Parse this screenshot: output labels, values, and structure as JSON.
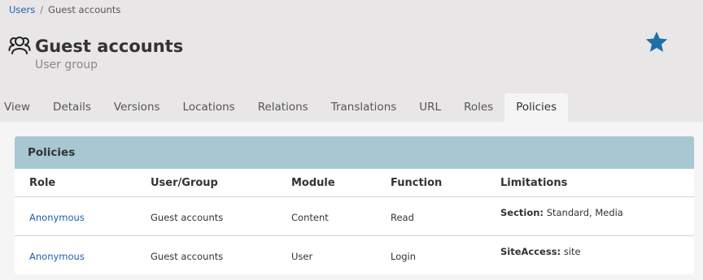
{
  "breadcrumb": {
    "parent": "Users",
    "separator": "/",
    "current": "Guest accounts"
  },
  "header": {
    "icon": "users-group-icon",
    "title": "Guest accounts",
    "subtitle": "User group",
    "bookmark_icon": "star-icon",
    "bookmark_color": "#1e6ea8"
  },
  "tabs": [
    {
      "label": "View",
      "active": false
    },
    {
      "label": "Details",
      "active": false
    },
    {
      "label": "Versions",
      "active": false
    },
    {
      "label": "Locations",
      "active": false
    },
    {
      "label": "Relations",
      "active": false
    },
    {
      "label": "Translations",
      "active": false
    },
    {
      "label": "URL",
      "active": false
    },
    {
      "label": "Roles",
      "active": false
    },
    {
      "label": "Policies",
      "active": true
    }
  ],
  "policies": {
    "title": "Policies",
    "columns": [
      "Role",
      "User/Group",
      "Module",
      "Function",
      "Limitations"
    ],
    "rows": [
      {
        "role": "Anonymous",
        "user_group": "Guest accounts",
        "module": "Content",
        "function": "Read",
        "limitation_label": "Section:",
        "limitation_value": "Standard, Media"
      },
      {
        "role": "Anonymous",
        "user_group": "Guest accounts",
        "module": "User",
        "function": "Login",
        "limitation_label": "SiteAccess:",
        "limitation_value": "site"
      }
    ]
  },
  "colors": {
    "accent": "#1e6ea8",
    "link": "#1f5fa8",
    "panel_header": "#a7c7d3",
    "background": "#e8e6e6"
  }
}
